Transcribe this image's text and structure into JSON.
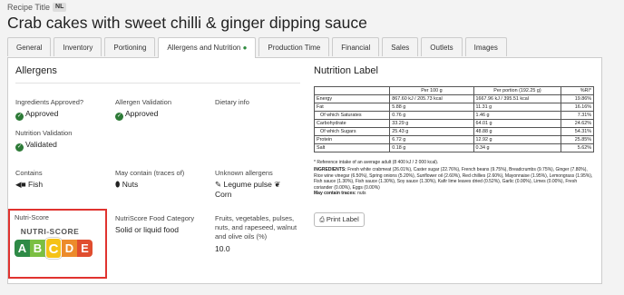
{
  "header": {
    "recipe_title_label": "Recipe Title",
    "lang_badge": "NL",
    "title": "Crab cakes with sweet chilli & ginger dipping sauce"
  },
  "tabs": [
    {
      "label": "General"
    },
    {
      "label": "Inventory"
    },
    {
      "label": "Portioning"
    },
    {
      "label": "Allergens and Nutrition"
    },
    {
      "label": "Production Time"
    },
    {
      "label": "Financial"
    },
    {
      "label": "Sales"
    },
    {
      "label": "Outlets"
    },
    {
      "label": "Images"
    }
  ],
  "allergens": {
    "heading": "Allergens",
    "ingredients_approved_label": "Ingredients Approved?",
    "ingredients_approved_value": "Approved",
    "allergen_validation_label": "Allergen Validation",
    "allergen_validation_value": "Approved",
    "dietary_info_label": "Dietary info",
    "nutrition_validation_label": "Nutrition Validation",
    "nutrition_validation_value": "Validated",
    "contains_label": "Contains",
    "contains_value": "Fish",
    "may_contain_label": "May contain (traces of)",
    "may_contain_value": "Nuts",
    "unknown_label": "Unknown allergens",
    "unknown_value_1": "Legume pulse",
    "unknown_value_2": "Corn",
    "nutriscore_label": "Nutri-Score",
    "nutriscore_logo_text": "NUTRI-SCORE",
    "nutriscore_grades": [
      "A",
      "B",
      "C",
      "D",
      "E"
    ],
    "nutriscore_selected": "C",
    "nutriscore_category_label": "NutriScore Food Category",
    "nutriscore_category_value": "Solid or liquid food",
    "fvp_label": "Fruits, vegetables, pulses, nuts, and rapeseed, walnut and olive oils (%)",
    "fvp_value": "10.0"
  },
  "nutrition": {
    "heading": "Nutrition Label",
    "col_per100": "Per 100 g",
    "col_portion": "Per portion (192.25 g)",
    "col_ri": "%RI*",
    "rows": [
      {
        "name": "Energy",
        "per100": "867.60 kJ / 205.73 kcal",
        "portion": "1667.96 kJ / 395.51 kcal",
        "ri": "19.86%"
      },
      {
        "name": "Fat",
        "per100": "5.88 g",
        "portion": "11.31 g",
        "ri": "16.16%"
      },
      {
        "name": "Of which Saturates",
        "per100": "0.76 g",
        "portion": "1.46 g",
        "ri": "7.31%"
      },
      {
        "name": "Carbohydrate",
        "per100": "33.29 g",
        "portion": "64.01 g",
        "ri": "24.62%"
      },
      {
        "name": "Of which Sugars",
        "per100": "25.43 g",
        "portion": "48.88 g",
        "ri": "54.31%"
      },
      {
        "name": "Protein",
        "per100": "6.72 g",
        "portion": "12.92 g",
        "ri": "25.85%"
      },
      {
        "name": "Salt",
        "per100": "0.18 g",
        "portion": "0.34 g",
        "ri": "5.62%"
      }
    ],
    "ri_note": "* Reference intake of an average adult (8 400 kJ / 2 000 kcal).",
    "ingredients_label": "INGREDIENTS:",
    "ingredients_text": "Fresh white crabmeat (26.01%), Caster sugar (22.76%), French beans (9.75%), Breadcrumbs (9.75%), Ginger (7.80%), Rice wine vinegar (6.50%), Spring onions (5.20%), Sunflower oil (2.60%), Red chillies (2.60%), Mayonnaise (1.95%), Lemongrass (1.95%), Fish sauce (1.30%), Fish sauce (1.30%), Soy sauce (1.30%), Kafir lime leaves dried (0.52%), Garlic (0.00%), Limes (0.00%), Fresh coriander (0.00%), Eggs (0.00%)",
    "may_contain_label": "May contain traces:",
    "may_contain_text": "nuts",
    "print_button": "Print Label"
  },
  "colors": {
    "nutriscore": [
      "#2e8a46",
      "#7bbf42",
      "#f5c217",
      "#ec8b2b",
      "#e04d2f"
    ],
    "highlight_border": "#e0332f",
    "check_green": "#2d7a37"
  }
}
